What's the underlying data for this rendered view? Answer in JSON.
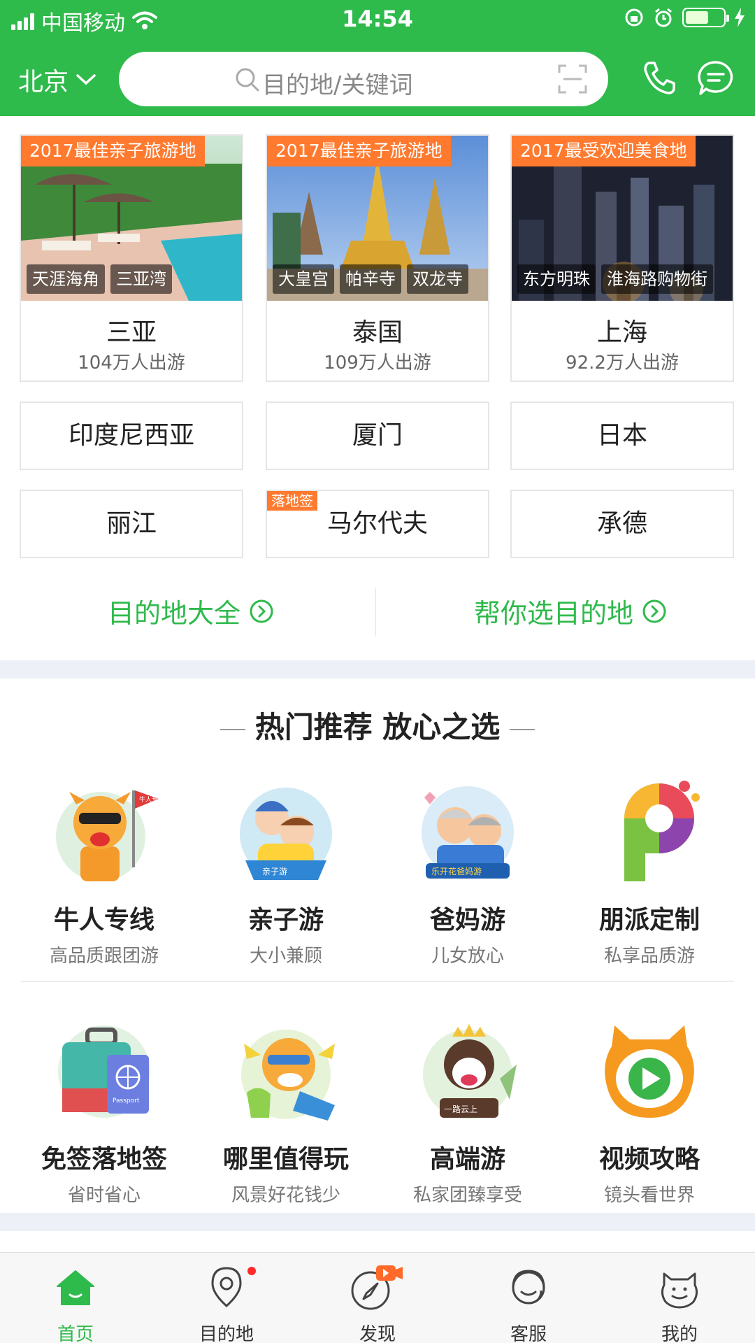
{
  "status_bar": {
    "carrier": "中国移动",
    "time": "14:54"
  },
  "header": {
    "city": "北京",
    "search_placeholder": "目的地/关键词"
  },
  "featured": [
    {
      "badge": "2017最佳亲子旅游地",
      "tags": [
        "天涯海角",
        "三亚湾"
      ],
      "name": "三亚",
      "count": "104万人出游"
    },
    {
      "badge": "2017最佳亲子旅游地",
      "tags": [
        "大皇宫",
        "帕辛寺",
        "双龙寺"
      ],
      "name": "泰国",
      "count": "109万人出游"
    },
    {
      "badge": "2017最受欢迎美食地",
      "tags": [
        "东方明珠",
        "淮海路购物街"
      ],
      "name": "上海",
      "count": "92.2万人出游"
    }
  ],
  "destinations": [
    {
      "name": "印度尼西亚"
    },
    {
      "name": "厦门"
    },
    {
      "name": "日本"
    },
    {
      "name": "丽江"
    },
    {
      "name": "马尔代夫",
      "tag": "落地签"
    },
    {
      "name": "承德"
    }
  ],
  "links": {
    "all": "目的地大全",
    "choose": "帮你选目的地"
  },
  "section": {
    "title": "热门推荐 放心之选"
  },
  "features": [
    {
      "title": "牛人专线",
      "subtitle": "高品质跟团游",
      "icon": "mascot-flag-icon",
      "icon_text": "牛人专线"
    },
    {
      "title": "亲子游",
      "subtitle": "大小兼顾",
      "icon": "family-kids-icon",
      "icon_text": "亲子游"
    },
    {
      "title": "爸妈游",
      "subtitle": "儿女放心",
      "icon": "elderly-couple-icon",
      "icon_text": "乐开花爸妈游"
    },
    {
      "title": "朋派定制",
      "subtitle": "私享品质游",
      "icon": "colorful-p-icon"
    },
    {
      "title": "免签落地签",
      "subtitle": "省时省心",
      "icon": "luggage-passport-icon",
      "icon_text": "Passport"
    },
    {
      "title": "哪里值得玩",
      "subtitle": "风景好花钱少",
      "icon": "mascot-relax-icon"
    },
    {
      "title": "高端游",
      "subtitle": "私家团臻享受",
      "icon": "mascot-crown-icon",
      "icon_text": "一路云上"
    },
    {
      "title": "视频攻略",
      "subtitle": "镜头看世界",
      "icon": "video-play-icon"
    }
  ],
  "tabs": [
    {
      "label": "首页",
      "icon": "home-icon"
    },
    {
      "label": "目的地",
      "icon": "location-pin-icon"
    },
    {
      "label": "发现",
      "icon": "compass-video-icon"
    },
    {
      "label": "客服",
      "icon": "customer-service-icon"
    },
    {
      "label": "我的",
      "icon": "mascot-head-icon"
    }
  ],
  "colors": {
    "brand_green": "#2fba4c",
    "badge_orange": "#ff7a2e",
    "notify_red": "#ff2a2a"
  }
}
